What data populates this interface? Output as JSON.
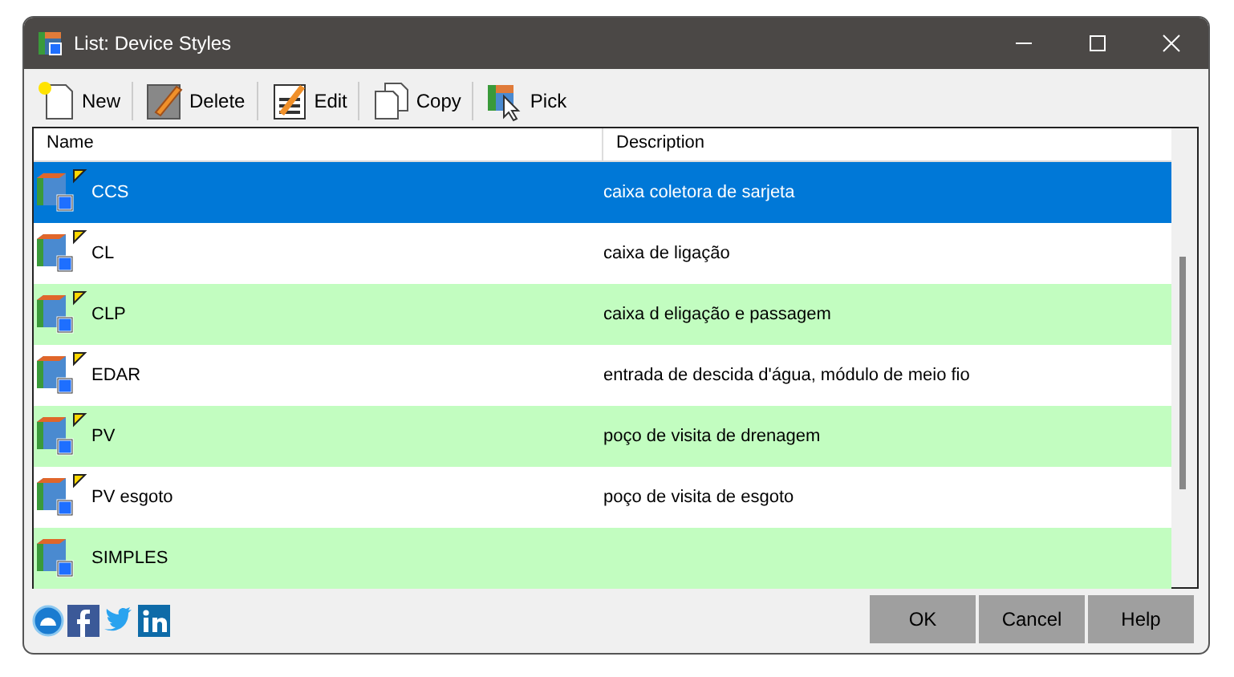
{
  "window": {
    "title": "List: Device Styles"
  },
  "toolbar": [
    {
      "label": "New",
      "kind": "new"
    },
    {
      "label": "Delete",
      "kind": "delete"
    },
    {
      "label": "Edit",
      "kind": "edit"
    },
    {
      "label": "Copy",
      "kind": "copy"
    },
    {
      "label": "Pick",
      "kind": "pick"
    }
  ],
  "table": {
    "columns": [
      "Name",
      "Description"
    ],
    "rows": [
      {
        "name": "CCS",
        "description": "caixa coletora de sarjeta",
        "selected": true,
        "flagged": true
      },
      {
        "name": "CL",
        "description": "caixa de ligação",
        "selected": false,
        "flagged": true
      },
      {
        "name": "CLP",
        "description": "caixa d eligação e passagem",
        "selected": false,
        "flagged": true
      },
      {
        "name": "EDAR",
        "description": "entrada de descida d'água, módulo de meio fio",
        "selected": false,
        "flagged": true
      },
      {
        "name": "PV",
        "description": "poço de visita de drenagem",
        "selected": false,
        "flagged": true
      },
      {
        "name": "PV esgoto",
        "description": "poço de visita de esgoto",
        "selected": false,
        "flagged": true
      },
      {
        "name": "SIMPLES",
        "selected": false,
        "flagged": false
      }
    ]
  },
  "social": [
    {
      "kind": "web"
    },
    {
      "kind": "facebook"
    },
    {
      "kind": "twitter"
    },
    {
      "kind": "linkedin"
    }
  ],
  "buttons": [
    "OK",
    "Cancel",
    "Help"
  ]
}
